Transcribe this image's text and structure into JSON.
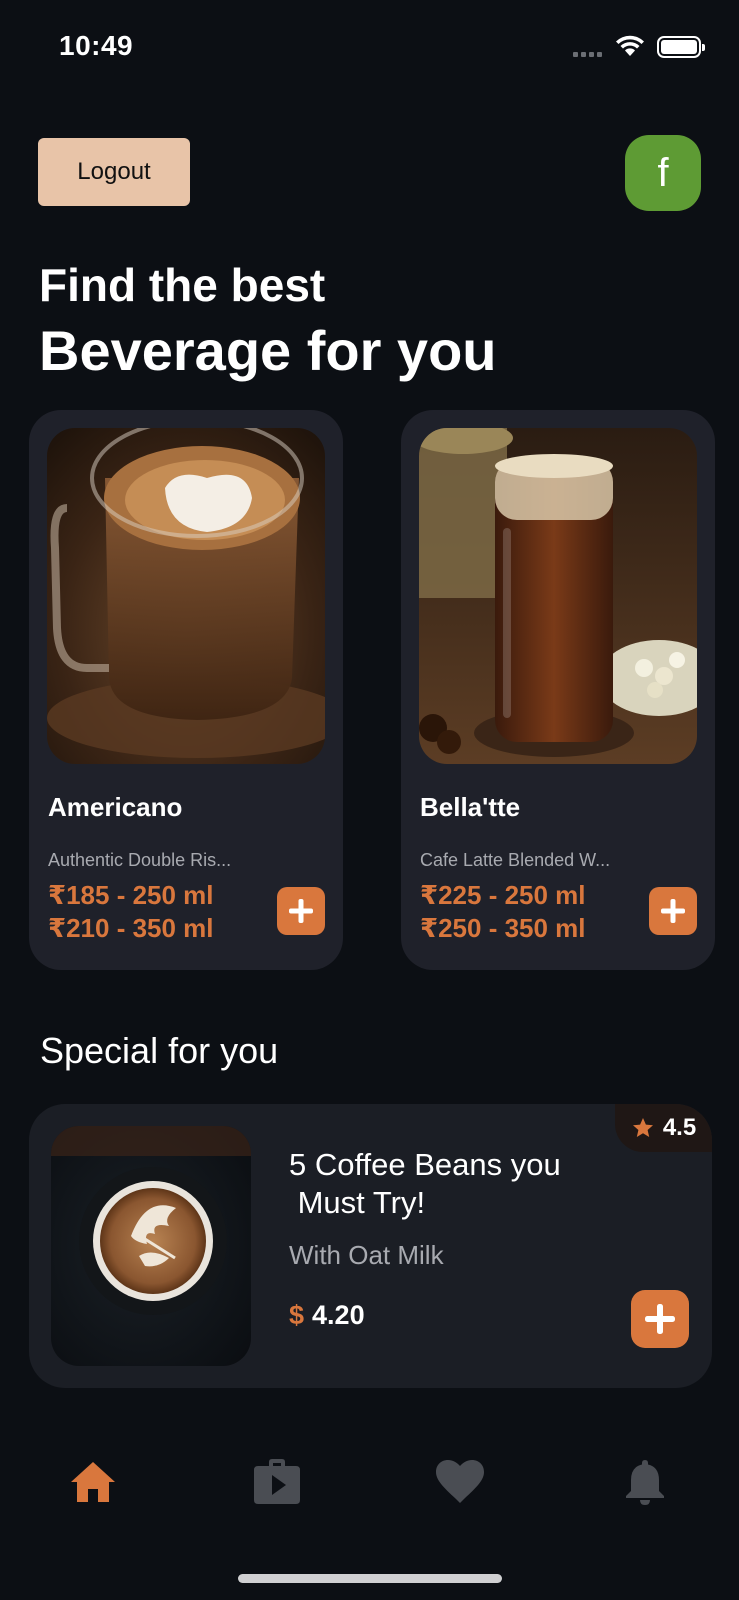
{
  "status_bar": {
    "time": "10:49"
  },
  "header": {
    "logout_label": "Logout",
    "avatar_initial": "f"
  },
  "headline": {
    "line1": "Find the best",
    "line2": "Beverage for you"
  },
  "beverages": [
    {
      "name": "Americano",
      "description": "Authentic Double Ris...",
      "price_small": "₹185 - 250 ml",
      "price_large": "₹210 - 350 ml",
      "icon": "plus-icon"
    },
    {
      "name": "Bella'tte",
      "description": "Cafe Latte Blended W...",
      "price_small": "₹225 - 250 ml",
      "price_large": "₹250 - 350 ml",
      "icon": "plus-icon"
    }
  ],
  "special": {
    "section_title": "Special for you",
    "name": "5 Coffee Beans you\n Must Try!",
    "subtitle": "With Oat Milk",
    "currency": "$",
    "price": "4.20",
    "rating": "4.5"
  },
  "tab_bar": {
    "tabs": [
      {
        "icon": "home-icon",
        "active": true
      },
      {
        "icon": "video-bag-icon",
        "active": false
      },
      {
        "icon": "heart-icon",
        "active": false
      },
      {
        "icon": "bell-icon",
        "active": false
      }
    ]
  },
  "colors": {
    "background": "#0c0f14",
    "card": "#1f212a",
    "accent": "#d9773d",
    "logout_bg": "#e8c4a8",
    "avatar_bg": "#5e9b34",
    "muted_text": "#a8aab0",
    "inactive_icon": "#4a4d53"
  }
}
